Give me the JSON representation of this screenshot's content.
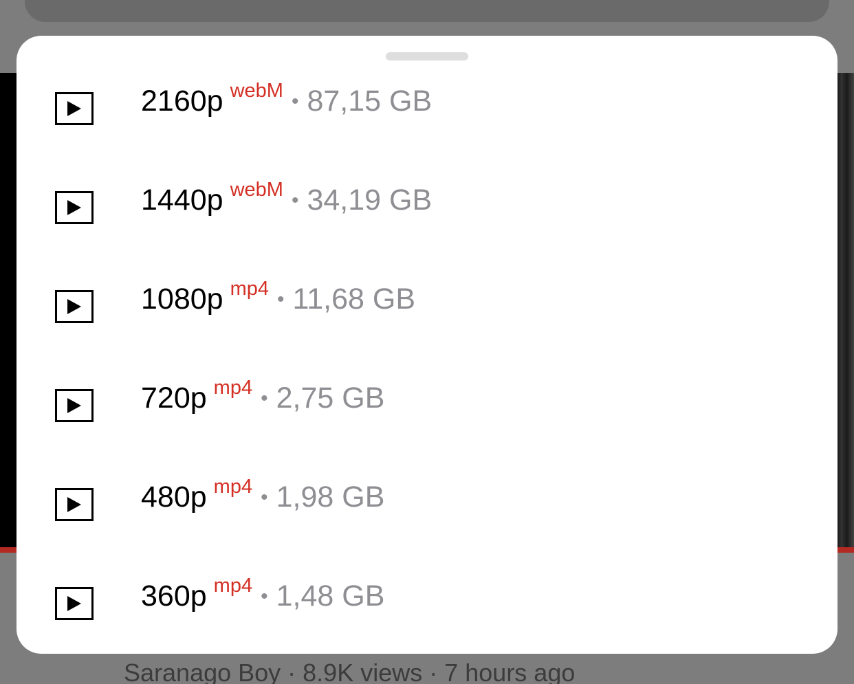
{
  "background": {
    "meta_line": "Saranago Boy · 8.9K views · 7 hours ago"
  },
  "sheet": {
    "options": [
      {
        "resolution": "2160p",
        "format": "webM",
        "separator": "•",
        "size": "87,15 GB"
      },
      {
        "resolution": "1440p",
        "format": "webM",
        "separator": "•",
        "size": "34,19 GB"
      },
      {
        "resolution": "1080p",
        "format": "mp4",
        "separator": "•",
        "size": "11,68 GB"
      },
      {
        "resolution": "720p",
        "format": "mp4",
        "separator": "•",
        "size": "2,75 GB"
      },
      {
        "resolution": "480p",
        "format": "mp4",
        "separator": "•",
        "size": "1,98 GB"
      },
      {
        "resolution": "360p",
        "format": "mp4",
        "separator": "•",
        "size": "1,48 GB"
      }
    ]
  },
  "colors": {
    "format_accent": "#d42f24",
    "size_gray": "#8e8e93",
    "progress_red": "#b22a22"
  },
  "icons": {
    "row_icon": "play-icon"
  }
}
